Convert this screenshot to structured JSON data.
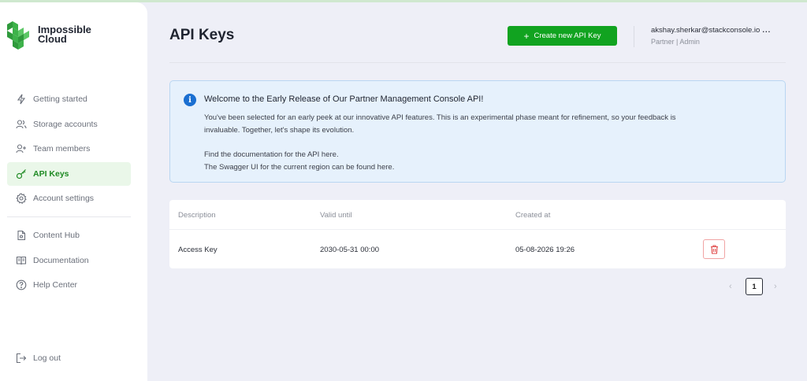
{
  "brand": {
    "name_line1": "Impossible",
    "name_line2": "Cloud",
    "accent": "#11a320"
  },
  "sidebar": {
    "items": [
      {
        "label": "Getting started",
        "icon": "lightning-icon"
      },
      {
        "label": "Storage accounts",
        "icon": "users-icon"
      },
      {
        "label": "Team members",
        "icon": "user-plus-icon"
      },
      {
        "label": "API Keys",
        "icon": "key-icon",
        "active": true
      },
      {
        "label": "Account settings",
        "icon": "gear-icon"
      }
    ],
    "secondary": [
      {
        "label": "Content Hub",
        "icon": "document-icon"
      },
      {
        "label": "Documentation",
        "icon": "book-icon"
      },
      {
        "label": "Help Center",
        "icon": "help-circle-icon"
      }
    ],
    "logout": {
      "label": "Log out",
      "icon": "logout-icon"
    }
  },
  "header": {
    "title": "API Keys",
    "create_button": "Create new API Key",
    "user_email": "akshay.sherkar@stackconsole.io",
    "user_menu": "...",
    "user_role": "Partner | Admin"
  },
  "info_banner": {
    "title": "Welcome to the Early Release of Our Partner Management Console API!",
    "line1": "You've been selected for an early peek at our innovative API features. This is an experimental phase meant for refinement, so your feedback is",
    "line2": "invaluable. Together, let's shape its evolution.",
    "line3": "Find the documentation for the API here.",
    "line4": "The Swagger UI for the current region can be found here."
  },
  "table": {
    "columns": [
      "Description",
      "Valid until",
      "Created at"
    ],
    "rows": [
      {
        "description": "Access Key",
        "valid_until": "2030-05-31 00:00",
        "created_at": "05-08-2026 19:26"
      }
    ]
  },
  "pagination": {
    "prev": "‹",
    "page": "1",
    "next": "›"
  }
}
